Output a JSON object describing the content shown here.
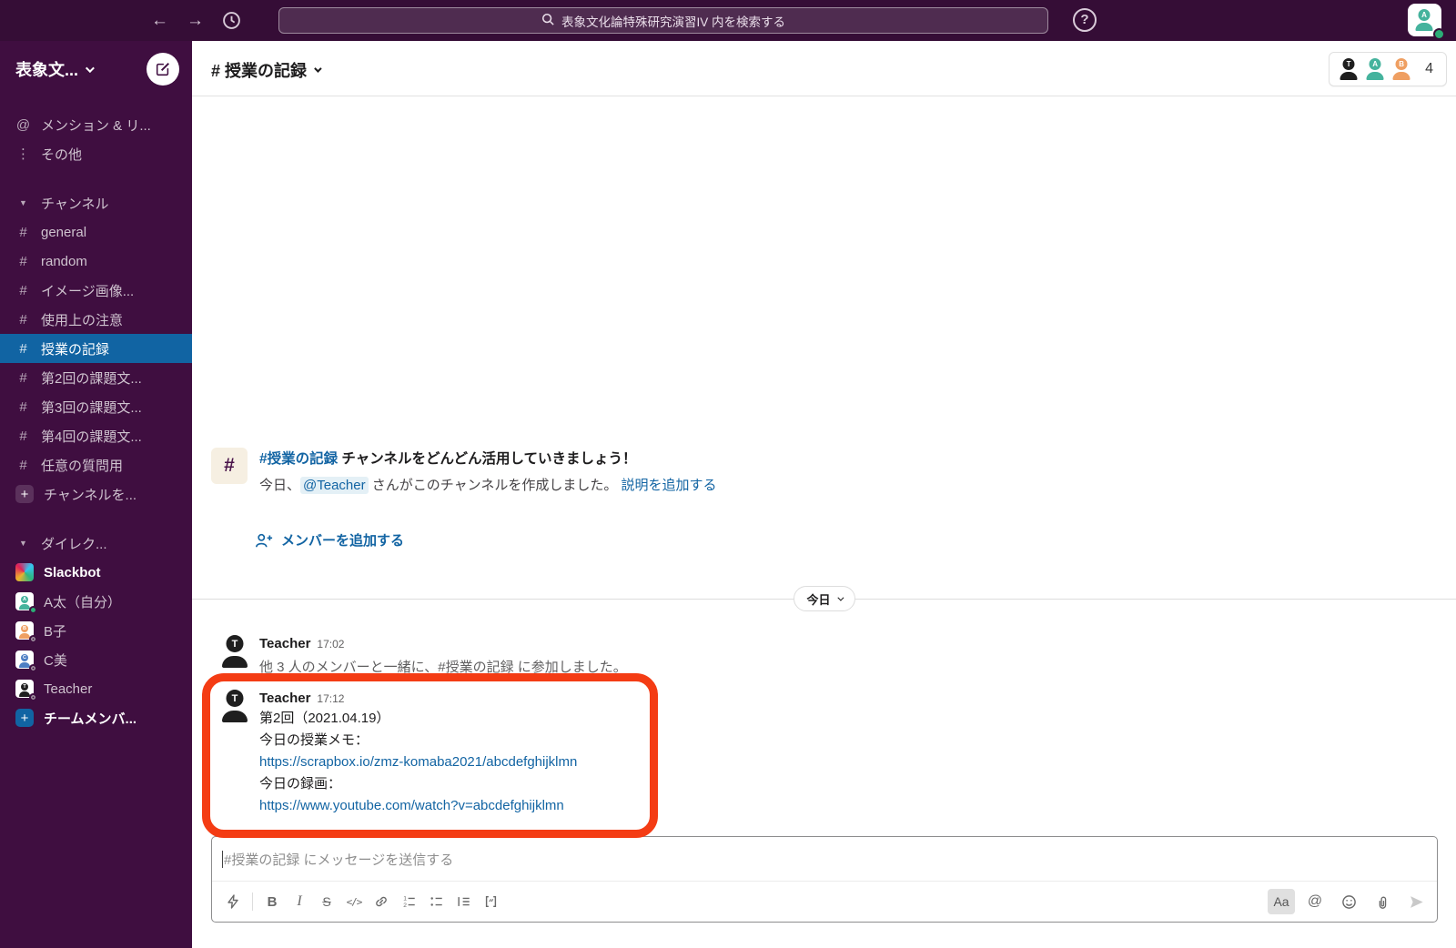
{
  "colors": {
    "topbar_bg": "#350D36",
    "sidebar_bg": "#3F0E40",
    "selected_item_bg": "#1164A3",
    "link_blue": "#1264A3",
    "highlight_red": "#F43C14",
    "presence_green": "#2BAC76",
    "avatar_black": "#1F1F1F",
    "avatar_teal": "#45B39D",
    "avatar_orange": "#EF9F62",
    "avatar_blue": "#4D7FC4"
  },
  "icons": {
    "back": "←",
    "forward": "→",
    "help": "?",
    "hash": "#",
    "at": "@",
    "more": "⋮",
    "caret_down": "▼",
    "plus": "+",
    "bold": "B",
    "italic": "I",
    "strike": "S",
    "code": "</>",
    "format": "Aa",
    "mention": "@"
  },
  "topbar": {
    "search_placeholder": "表象文化論特殊研究演習IV 内を検索する"
  },
  "sidebar": {
    "workspace_name": "表象文...",
    "mentions_label": "メンション & リ...",
    "more_label": "その他",
    "channels_header": "チャンネル",
    "channels": [
      {
        "name": "general"
      },
      {
        "name": "random"
      },
      {
        "name": "イメージ画像..."
      },
      {
        "name": "使用上の注意"
      },
      {
        "name": "授業の記録"
      },
      {
        "name": "第2回の課題文..."
      },
      {
        "name": "第3回の課題文..."
      },
      {
        "name": "第4回の課題文..."
      },
      {
        "name": "任意の質問用"
      }
    ],
    "add_channel_label": "チャンネルを...",
    "dm_header": "ダイレク...",
    "dms": [
      {
        "name": "Slackbot",
        "initial": ""
      },
      {
        "name": "A太（自分）",
        "initial": "A"
      },
      {
        "name": "B子",
        "initial": "B"
      },
      {
        "name": "C美",
        "initial": "C"
      },
      {
        "name": "Teacher",
        "initial": "T"
      }
    ],
    "invite_label": "チームメンバ..."
  },
  "channel_header": {
    "title": "# 授業の記録",
    "member_initials": [
      "T",
      "A",
      "B"
    ],
    "member_count": "4"
  },
  "intro": {
    "title_channel": "#授業の記録",
    "title_rest": " チャンネルをどんどん活用していきましょう！",
    "desc_prefix": "今日、",
    "mention": "@Teacher",
    "desc_suffix": " さんがこのチャンネルを作成しました。",
    "add_description_link": "説明を追加する",
    "add_members_link": "メンバーを追加する"
  },
  "date_divider": {
    "label": "今日"
  },
  "messages": [
    {
      "author": "Teacher",
      "initial": "T",
      "time": "17:02",
      "text": "他 3 人のメンバーと一緒に、#授業の記録 に参加しました。"
    },
    {
      "author": "Teacher",
      "initial": "T",
      "time": "17:12",
      "lines": [
        "第2回（2021.04.19）",
        "今日の授業メモ：",
        "https://scrapbox.io/zmz-komaba2021/abcdefghijklmn",
        "今日の録画：",
        "https://www.youtube.com/watch?v=abcdefghijklmn"
      ]
    }
  ],
  "composer": {
    "placeholder": "#授業の記録 にメッセージを送信する"
  }
}
